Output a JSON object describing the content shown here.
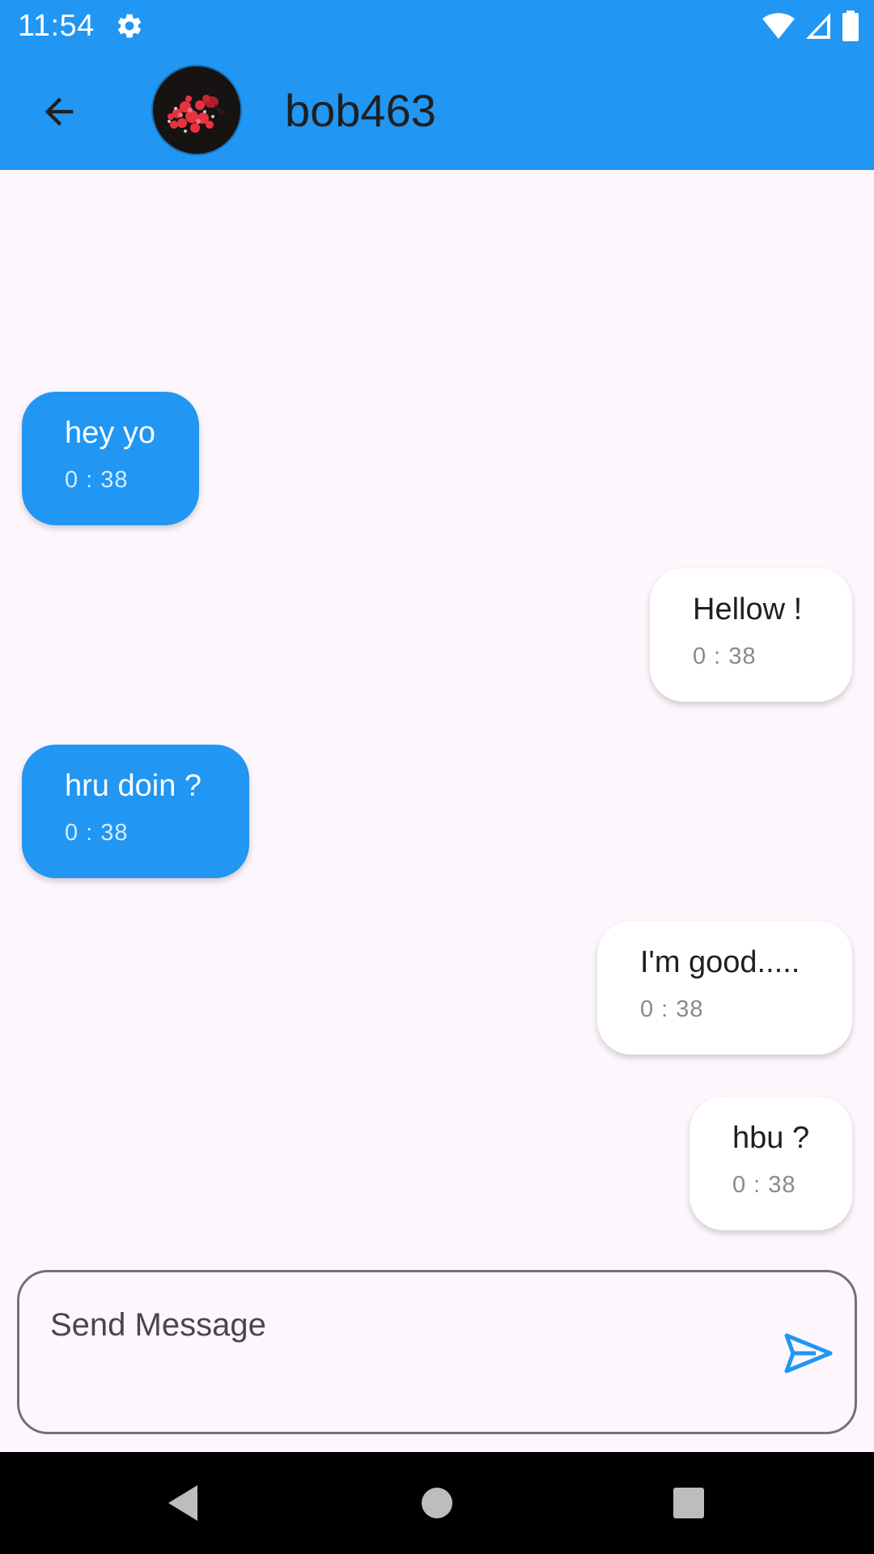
{
  "status_bar": {
    "time": "11:54",
    "icons": [
      "gear-icon",
      "wifi-icon",
      "signal-icon",
      "battery-icon"
    ]
  },
  "app_bar": {
    "title": "bob463",
    "back_icon": "arrow-back-icon",
    "avatar": "contact-avatar"
  },
  "messages": [
    {
      "direction": "incoming",
      "text": "hey yo",
      "time": "0 : 38"
    },
    {
      "direction": "outgoing",
      "text": "Hellow !",
      "time": "0 : 38"
    },
    {
      "direction": "incoming",
      "text": "hru doin ?",
      "time": "0 : 38"
    },
    {
      "direction": "outgoing",
      "text": "I'm good.....",
      "time": "0 : 38"
    },
    {
      "direction": "outgoing",
      "text": "hbu ?",
      "time": "0 : 38"
    }
  ],
  "composer": {
    "placeholder": "Send Message",
    "value": "",
    "send_icon": "send-icon"
  },
  "nav_bar": {
    "buttons": [
      "back-nav-icon",
      "home-nav-icon",
      "recents-nav-icon"
    ]
  },
  "colors": {
    "accent": "#2196F3",
    "background": "#FDF7FD",
    "outgoing_bubble": "#FFFFFF",
    "incoming_bubble": "#2196F3"
  }
}
